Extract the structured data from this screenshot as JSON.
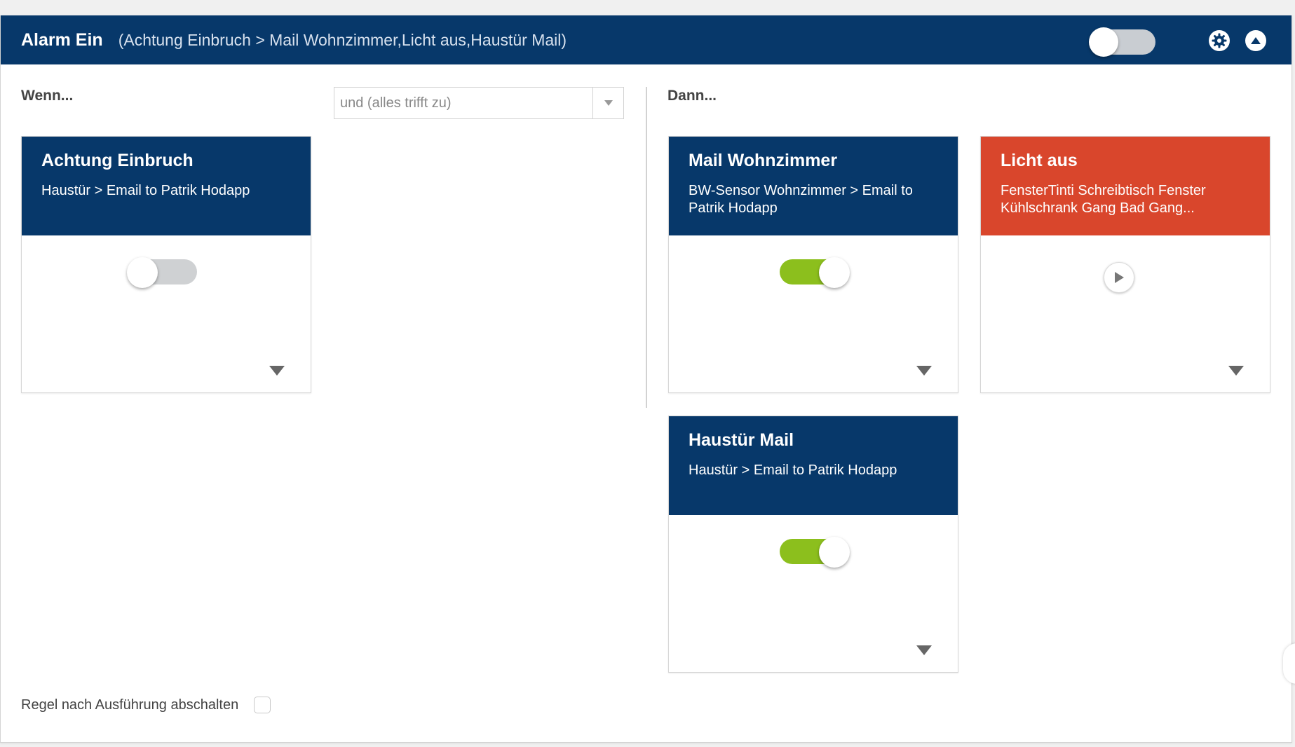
{
  "header": {
    "title": "Alarm Ein",
    "subtitle": "(Achtung Einbruch > Mail Wohnzimmer,Licht aus,Haustür Mail)",
    "rule_enabled": false
  },
  "conditions": {
    "label": "Wenn...",
    "logic_select": {
      "value": "und (alles trifft zu)"
    },
    "cards": [
      {
        "title": "Achtung Einbruch",
        "desc": "Haustür > Email to Patrik Hodapp",
        "enabled": false
      }
    ]
  },
  "actions": {
    "label": "Dann...",
    "cards": [
      {
        "title": "Mail Wohnzimmer",
        "desc": "BW-Sensor Wohnzimmer > Email to Patrik Hodapp",
        "enabled": true,
        "color": "#07386a"
      },
      {
        "title": "Licht aus",
        "desc": "FensterTinti Schreibtisch Fenster Kühlschrank Gang Bad Gang...",
        "color": "#d9462c",
        "control": "play"
      },
      {
        "title": "Haustür Mail",
        "desc": "Haustür > Email to Patrik Hodapp",
        "enabled": true,
        "color": "#07386a"
      }
    ]
  },
  "footer": {
    "disable_after_run_label": "Regel nach Ausführung abschalten",
    "disable_after_run_checked": false
  },
  "colors": {
    "navy": "#07386a",
    "red": "#d9462c",
    "green": "#8cbf1d"
  }
}
